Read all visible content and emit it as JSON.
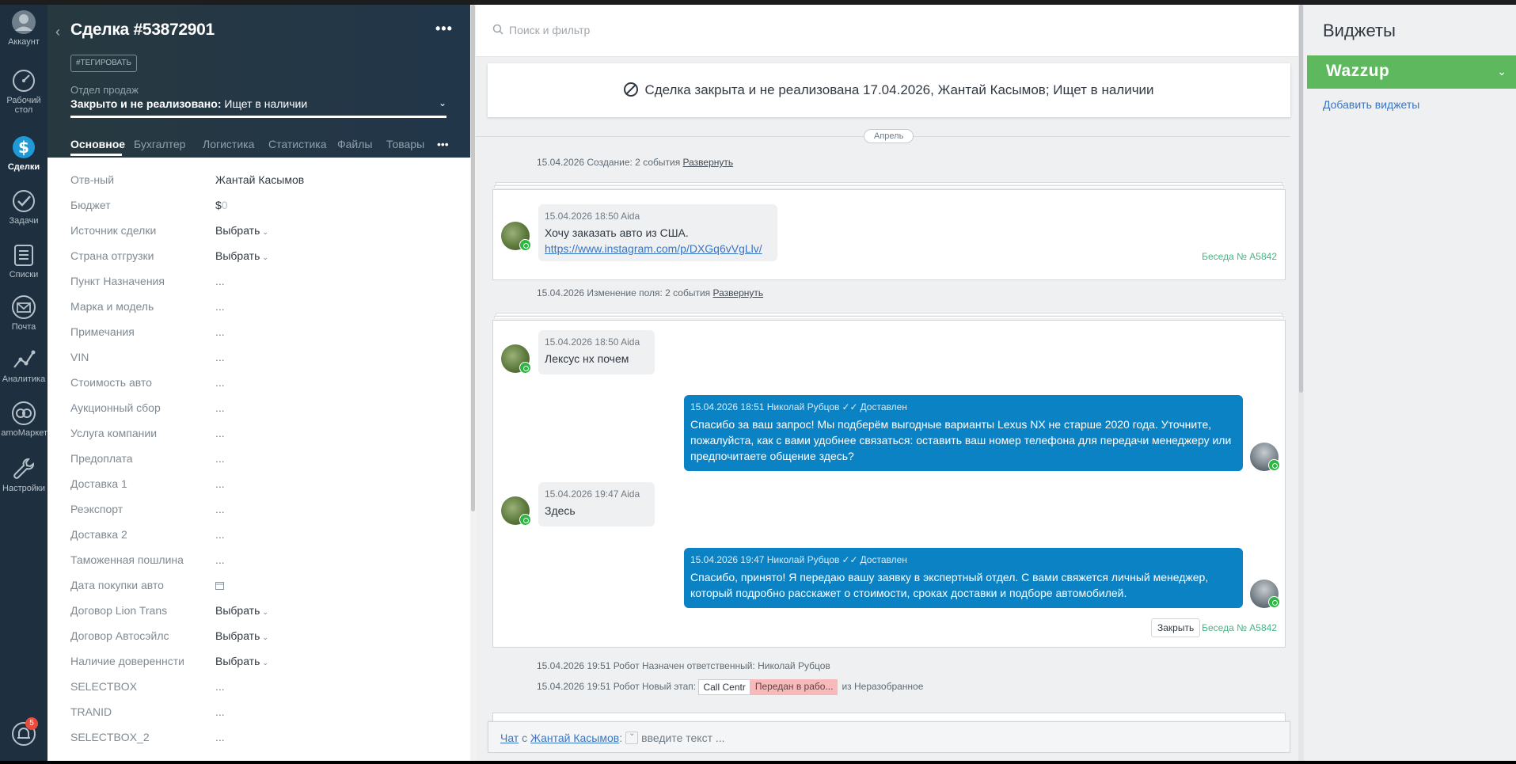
{
  "nav": {
    "items": [
      {
        "label": "Аккаунт",
        "icon": "account-icon"
      },
      {
        "label": "Рабочий стол",
        "icon": "dashboard-icon"
      },
      {
        "label": "Сделки",
        "icon": "deals-icon"
      },
      {
        "label": "Задачи",
        "icon": "tasks-icon"
      },
      {
        "label": "Списки",
        "icon": "lists-icon"
      },
      {
        "label": "Почта",
        "icon": "mail-icon"
      },
      {
        "label": "Аналитика",
        "icon": "analytics-icon"
      },
      {
        "label": "amoМаркет",
        "icon": "market-icon"
      },
      {
        "label": "Настройки",
        "icon": "settings-icon"
      }
    ],
    "notifications_count": "5"
  },
  "card": {
    "title": "Сделка #53872901",
    "tag_button": "#ТЕГИРОВАТЬ",
    "pipeline_label": "Отдел продаж",
    "status_bold": "Закрыто и не реализовано:",
    "status_reason": "Ищет в наличии",
    "tabs": [
      "Основное",
      "Бухгалтер",
      "Логистика",
      "Статистика",
      "Файлы",
      "Товары"
    ],
    "fields": [
      {
        "key": "Отв-ный",
        "value": "Жантай Касымов"
      },
      {
        "key": "Бюджет",
        "value": "$",
        "value_extra": "0"
      },
      {
        "key": "Источник сделки",
        "value": "Выбрать"
      },
      {
        "key": "Страна отгрузки",
        "value": "Выбрать"
      },
      {
        "key": "Пункт Назначения",
        "value": "..."
      },
      {
        "key": "Марка и модель",
        "value": "..."
      },
      {
        "key": "Примечания",
        "value": "..."
      },
      {
        "key": "VIN",
        "value": "..."
      },
      {
        "key": "Стоимость авто",
        "value": "..."
      },
      {
        "key": "Аукционный сбор",
        "value": "..."
      },
      {
        "key": "Услуга компании",
        "value": "..."
      },
      {
        "key": "Предоплата",
        "value": "..."
      },
      {
        "key": "Доставка 1",
        "value": "..."
      },
      {
        "key": "Реэкспорт",
        "value": "..."
      },
      {
        "key": "Доставка 2",
        "value": "..."
      },
      {
        "key": "Таможенная пошлина",
        "value": "..."
      },
      {
        "key": "Дата покупки авто",
        "value": ""
      },
      {
        "key": "Договор Lion Trans",
        "value": "Выбрать"
      },
      {
        "key": "Договор Автосэйлс",
        "value": "Выбрать"
      },
      {
        "key": "Наличие довереннсти",
        "value": "Выбрать"
      },
      {
        "key": "SELECTBOX",
        "value": "..."
      },
      {
        "key": "TRANID",
        "value": "..."
      },
      {
        "key": "SELECTBOX_2",
        "value": "..."
      }
    ]
  },
  "feed": {
    "search_placeholder": "Поиск и фильтр",
    "closed_banner": "Сделка закрыта и не реализована 17.04.2026, Жантай Касымов; Ищет в наличии",
    "month": "Апрель",
    "events": [
      {
        "text": "15.04.2026 Создание: 2 события ",
        "link": "Развернуть"
      },
      {
        "text": "15.04.2026 Изменение поля: 2 события ",
        "link": "Развернуть"
      }
    ],
    "conversation1": {
      "messages": [
        {
          "meta": "15.04.2026 18:50 Aida",
          "text": "Хочу заказать авто из США.",
          "link": "https://www.instagram.com/p/DXGq6vVgLlv/"
        }
      ],
      "conv_id": "Беседа № A5842"
    },
    "conversation2": {
      "in1": {
        "meta": "15.04.2026 18:50 Aida",
        "text": "Лексус нх почем"
      },
      "out1": {
        "meta": "15.04.2026 18:51 Николай Рубцов",
        "status": "Доставлен",
        "text": "Спасибо за ваш запрос! Мы подберём выгодные варианты Lexus NX не старше 2020 года. Уточните, пожалуйста, как с вами удобнее связаться: оставить ваш номер телефона для передачи менеджеру или предпочитаете общение здесь?"
      },
      "in2": {
        "meta": "15.04.2026 19:47 Aida",
        "text": "Здесь"
      },
      "out2": {
        "meta": "15.04.2026 19:47 Николай Рубцов",
        "status": "Доставлен",
        "text": "Спасибо, принято! Я передаю вашу заявку в экспертный отдел. С вами свяжется личный менеджер, который подробно расскажет о стоимости, сроках доставки и подборе автомобилей."
      },
      "close_label": "Закрыть",
      "conv_id": "Беседа № A5842"
    },
    "robot1": "15.04.2026 19:51 Робот Назначен ответственный: Николай Рубцов",
    "robot2": {
      "prefix": "15.04.2026 19:51 Робот Новый этап: ",
      "stage_from": "Call Centr",
      "stage_to": "Передан в рабо...",
      "suffix": "из Неразобранное"
    },
    "chat_input": {
      "chat_label": "Чат",
      "with": " с ",
      "contact": "Жантай Касымов",
      "colon": ":",
      "placeholder": "введите текст ..."
    }
  },
  "widgets": {
    "title": "Виджеты",
    "wazzup": "Wazzup",
    "add": "Добавить виджеты"
  }
}
